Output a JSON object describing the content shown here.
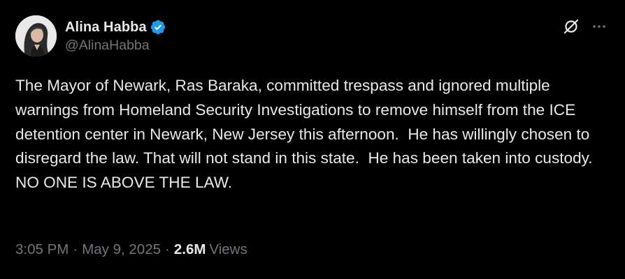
{
  "author": {
    "display_name": "Alina Habba",
    "handle": "@AlinaHabba",
    "verified_icon": "verified-badge-icon",
    "verified_color": "#1d9bf0"
  },
  "actions": {
    "grok_icon": "grok-icon",
    "more_icon": "more-icon"
  },
  "post": {
    "text": "The Mayor of Newark, Ras Baraka, committed trespass and ignored multiple warnings from Homeland Security Investigations to remove himself from the ICE detention center in Newark, New Jersey this afternoon.  He has willingly chosen to disregard the law. That will not stand in this state.  He has been taken into custody. NO ONE IS ABOVE THE LAW."
  },
  "meta": {
    "time": "3:05 PM",
    "separator": "·",
    "date": "May 9, 2025",
    "views_count": "2.6M",
    "views_label": "Views"
  },
  "colors": {
    "background": "#000000",
    "text_primary": "#e7e9ea",
    "text_secondary": "#71767b"
  }
}
